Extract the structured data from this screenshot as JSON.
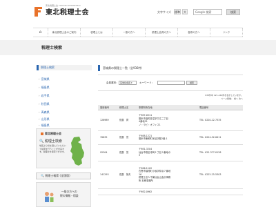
{
  "header": {
    "logo_sub": "東北税理士会 TOHOKU ZEIRISHIKAI",
    "logo_text": "東北税理士会",
    "font_size_label": "文字サイズ",
    "font_buttons": [
      "標準",
      "大"
    ],
    "search_value": "Google 検索",
    "search_button": "検索"
  },
  "nav": [
    "東北税理士会のご案内",
    "税理士とは",
    "一般の方へ",
    "税理士会員の方へ",
    "各県の方へ",
    "リンク"
  ],
  "page_title": "税理士検索",
  "sidebar": {
    "heading": "税理士検索",
    "items": [
      "宮城県",
      "福島県",
      "岩手県",
      "秋田県",
      "青森県",
      "山形県",
      "福島県"
    ]
  },
  "banner": {
    "logo": "東北税理士会",
    "title": "税理士検索",
    "text": "地区より県を選んでいただいて検索を行うことが出来ます。税理士を検索できます。",
    "button": "税理士検索 (全国版)",
    "bottom_text": "一般の方への\n税の情報・相談"
  },
  "main": {
    "heading": "宮城県の税理士一覧（全938件）",
    "search_label": "会員選択：",
    "select_value": "宮城県会員",
    "keyword_label": "キーワード：",
    "search_button": "検索",
    "count_line1": "938件中 421-440件を表示しています。",
    "count_line2": "ページ移動：  前へ  次へ"
  },
  "table": {
    "headers": [
      "登録番号",
      "税理士名",
      "事務所所在地",
      "電話番号"
    ],
    "rows": [
      {
        "no": "126989",
        "name": "佐藤　潤",
        "addr": "〒987-0511\n登米市迫町佐沼字中江二丁目\n4番地21\nノ・ラビ・オフィス1",
        "tel": "TEL: 0220-22-7335"
      },
      {
        "no": "70635",
        "name": "佐藤　茂",
        "addr": "〒988-1221\n登米市東和町米谷字錦2番-1",
        "tel": "TEL: 0224-52-0011"
      },
      {
        "no": "92304",
        "name": "佐藤　茂",
        "addr": "〒981-3204\n仙台市泉区寺岡１丁目２番地の\n3",
        "tel": "TEL: 022-377-0128"
      },
      {
        "no": "141293",
        "name": "佐藤　静夫",
        "addr": "〒986-1102\n石巻市須賀町小坂字仲浜７番地\n16\n税理士法人千葉仙台山会計事務\n所 石巻事務所",
        "tel": "TEL: 0225-25-5303"
      },
      {
        "no": "",
        "name": "",
        "addr": "〒982-0962",
        "tel": ""
      }
    ]
  },
  "colors": {
    "accent": "#2a66b0",
    "brand": "#e8722a"
  }
}
